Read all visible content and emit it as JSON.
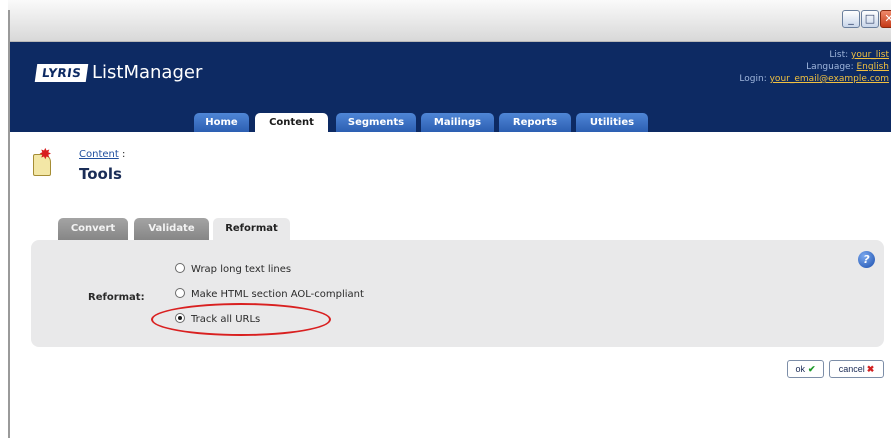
{
  "window": {
    "controls": [
      "_",
      "□",
      "✕"
    ]
  },
  "header": {
    "logo": "LYRIS",
    "app_title": "ListManager",
    "list_label": "List:",
    "list_value": "your_list",
    "language_label": "Language:",
    "language_value": "English",
    "login_label": "Login:",
    "login_value": "your_email@example.com"
  },
  "tabs": [
    {
      "label": "Home"
    },
    {
      "label": "Content",
      "active": true
    },
    {
      "label": "Segments"
    },
    {
      "label": "Mailings"
    },
    {
      "label": "Reports"
    },
    {
      "label": "Utilities"
    }
  ],
  "breadcrumb": {
    "link": "Content",
    "separator": ":"
  },
  "page_title": "Tools",
  "subtabs": [
    {
      "label": "Convert"
    },
    {
      "label": "Validate"
    },
    {
      "label": "Reformat",
      "active": true
    }
  ],
  "form": {
    "label": "Reformat:",
    "options": [
      {
        "label": "Wrap long text lines",
        "checked": false
      },
      {
        "label": "Make HTML section AOL-compliant",
        "checked": false
      },
      {
        "label": "Track all URLs",
        "checked": true
      }
    ]
  },
  "actions": {
    "ok_label": "ok",
    "cancel_label": "cancel"
  },
  "colors": {
    "header_bg": "#0d2a63",
    "tab_bg": "#2c5fb2",
    "panel_bg": "#e9e9ea",
    "highlight": "#d92020",
    "link": "#1f4f9e",
    "accent_yellow": "#f0c040"
  }
}
